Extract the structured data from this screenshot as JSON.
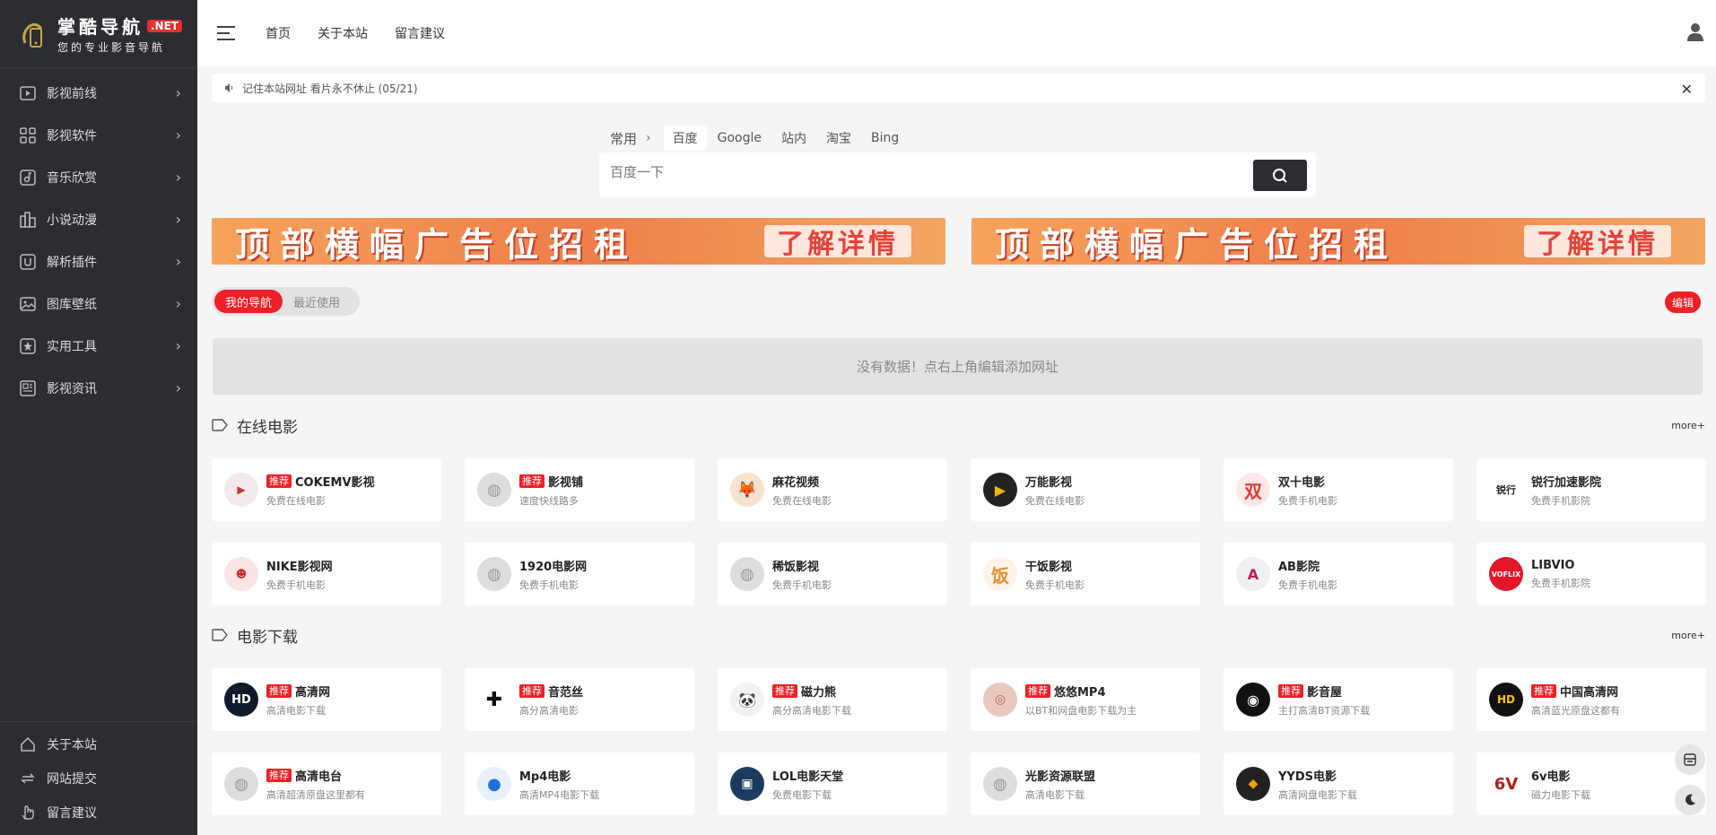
{
  "brand": {
    "title": "掌酷导航",
    "badge": ".NET",
    "subtitle": "您的专业影音导航"
  },
  "sidebar": {
    "items": [
      {
        "label": "影视前线",
        "icon": "play-icon"
      },
      {
        "label": "影视软件",
        "icon": "apps-icon"
      },
      {
        "label": "音乐欣赏",
        "icon": "music-icon"
      },
      {
        "label": "小说动漫",
        "icon": "books-icon"
      },
      {
        "label": "解析插件",
        "icon": "plugin-icon"
      },
      {
        "label": "图库壁纸",
        "icon": "image-icon"
      },
      {
        "label": "实用工具",
        "icon": "tool-icon"
      },
      {
        "label": "影视资讯",
        "icon": "news-icon"
      }
    ],
    "bottom": [
      {
        "label": "关于本站",
        "icon": "home-icon"
      },
      {
        "label": "网站提交",
        "icon": "refresh-icon"
      },
      {
        "label": "留言建议",
        "icon": "hand-icon"
      }
    ]
  },
  "header": {
    "nav": [
      "首页",
      "关于本站",
      "留言建议"
    ]
  },
  "notice": {
    "text": "记住本站网址 看片永不休止 (05/21)"
  },
  "search": {
    "group": "常用",
    "tabs": [
      "百度",
      "Google",
      "站内",
      "淘宝",
      "Bing"
    ],
    "active_tab": "百度",
    "placeholder": "百度一下"
  },
  "banners": [
    {
      "text": "顶部横幅广告位招租",
      "cta": "了解详情"
    },
    {
      "text": "顶部横幅广告位招租",
      "cta": "了解详情"
    }
  ],
  "mynav": {
    "tabs": [
      "我的导航",
      "最近使用"
    ],
    "edit": "编辑",
    "empty": "没有数据！点右上角编辑添加网址"
  },
  "sections": [
    {
      "title": "在线电影",
      "more": "more+",
      "cards": [
        {
          "title": "COKEMV影视",
          "desc": "免费在线电影",
          "tag": "推荐",
          "icon": "cokemv-logo"
        },
        {
          "title": "影视铺",
          "desc": "速度快线路多",
          "tag": "推荐",
          "icon": "globe-icon"
        },
        {
          "title": "麻花视频",
          "desc": "免费在线电影",
          "tag": "",
          "icon": "fox-logo"
        },
        {
          "title": "万能影视",
          "desc": "免费在线电影",
          "tag": "",
          "icon": "play-circle-logo"
        },
        {
          "title": "双十电影",
          "desc": "免费手机电影",
          "tag": "",
          "icon": "shuang-logo"
        },
        {
          "title": "锐行加速影院",
          "desc": "免费手机影院",
          "tag": "",
          "icon": "ruixing-logo"
        },
        {
          "title": "NIKE影视网",
          "desc": "免费手机电影",
          "tag": "",
          "icon": "nike-logo"
        },
        {
          "title": "1920电影网",
          "desc": "免费手机电影",
          "tag": "",
          "icon": "globe-icon"
        },
        {
          "title": "稀饭影视",
          "desc": "免费手机电影",
          "tag": "",
          "icon": "globe-icon"
        },
        {
          "title": "干饭影视",
          "desc": "免费手机电影",
          "tag": "",
          "icon": "fan-logo"
        },
        {
          "title": "AB影院",
          "desc": "免费手机电影",
          "tag": "",
          "icon": "ab-logo"
        },
        {
          "title": "LIBVIO",
          "desc": "免费手机影院",
          "tag": "",
          "icon": "voflix-logo"
        }
      ]
    },
    {
      "title": "电影下载",
      "more": "more+",
      "cards": [
        {
          "title": "高清网",
          "desc": "高清电影下载",
          "tag": "推荐",
          "icon": "hd-logo"
        },
        {
          "title": "音范丝",
          "desc": "高分高清电影",
          "tag": "推荐",
          "icon": "grid-logo"
        },
        {
          "title": "磁力熊",
          "desc": "高分高清电影下载",
          "tag": "推荐",
          "icon": "panda-logo"
        },
        {
          "title": "悠悠MP4",
          "desc": "以BT和网盘电影下载为主",
          "tag": "推荐",
          "icon": "blur-logo"
        },
        {
          "title": "影音屋",
          "desc": "主打高清BT资源下载",
          "tag": "推荐",
          "icon": "vinyl-logo"
        },
        {
          "title": "中国高清网",
          "desc": "高清蓝光原盘这都有",
          "tag": "推荐",
          "icon": "hd-yellow-logo"
        },
        {
          "title": "高清电台",
          "desc": "高清超清原盘这里都有",
          "tag": "推荐",
          "icon": "globe-icon"
        },
        {
          "title": "Mp4电影",
          "desc": "高清MP4电影下载",
          "tag": "",
          "icon": "blue-ball-logo"
        },
        {
          "title": "LOL电影天堂",
          "desc": "免费电影下载",
          "tag": "",
          "icon": "film-logo"
        },
        {
          "title": "光影资源联盟",
          "desc": "高清电影下载",
          "tag": "",
          "icon": "globe-icon"
        },
        {
          "title": "YYDS电影",
          "desc": "高清网盘电影下载",
          "tag": "",
          "icon": "yyds-logo"
        },
        {
          "title": "6v电影",
          "desc": "磁力电影下载",
          "tag": "",
          "icon": "6v-logo"
        }
      ]
    }
  ],
  "colors": {
    "sidebar_bg": "#2b2d31",
    "accent": "#ee1f25",
    "page_bg": "#f5f5f5"
  }
}
